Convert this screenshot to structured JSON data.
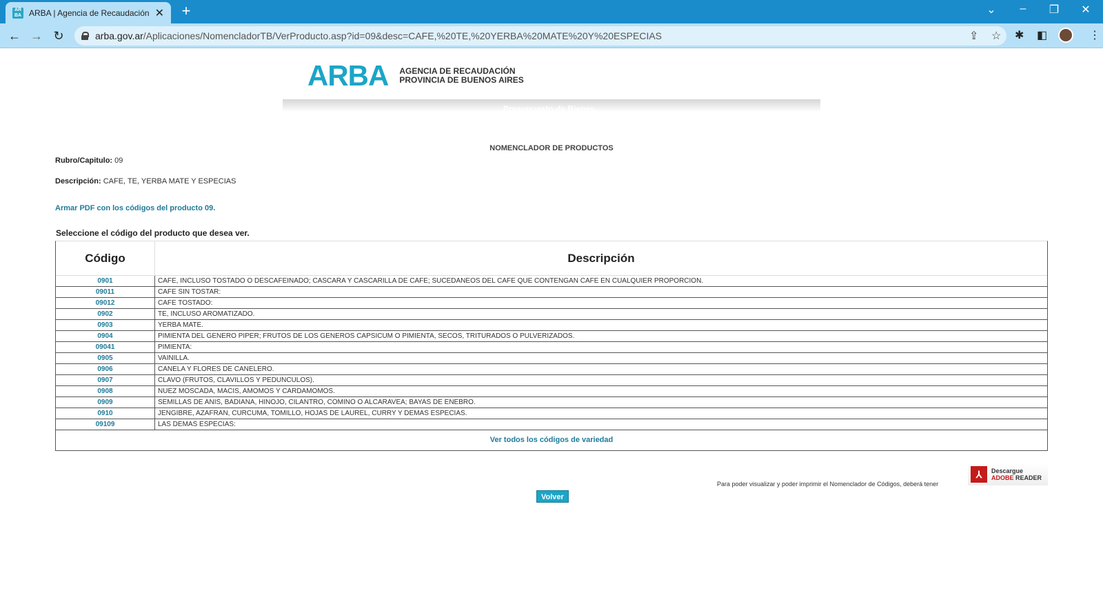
{
  "browser": {
    "tab_title": "ARBA | Agencia de Recaudación de la Provincia",
    "url_host": "arba.gov.ar",
    "url_path": "/Aplicaciones/NomencladorTB/VerProducto.asp?id=09&desc=CAFE,%20TE,%20YERBA%20MATE%20Y%20ESPECIAS"
  },
  "header": {
    "logo": "ARBA",
    "logo_sub_1": "AGENCIA DE RECAUDACIÓN",
    "logo_sub_2": "PROVINCIA DE BUENOS AIRES",
    "banner_text": "Presupuesto de Bienes"
  },
  "main": {
    "heading": "NOMENCLADOR DE PRODUCTOS",
    "rubro_label": "Rubro/Capitulo:",
    "rubro_value": "09",
    "desc_label": "Descripción:",
    "desc_value": "CAFE, TE, YERBA MATE Y ESPECIAS",
    "pdf_link": "Armar PDF con los códigos del producto 09.",
    "select_label": "Seleccione el código del producto que desea ver.",
    "table": {
      "col_code": "Código",
      "col_desc": "Descripción",
      "rows": [
        {
          "code": "0901",
          "desc": "CAFE, INCLUSO TOSTADO O DESCAFEINADO; CASCARA Y CASCARILLA DE CAFE; SUCEDANEOS DEL CAFE QUE CONTENGAN CAFE EN CUALQUIER PROPORCION."
        },
        {
          "code": "09011",
          "desc": "CAFE SIN TOSTAR:"
        },
        {
          "code": "09012",
          "desc": "CAFE TOSTADO:"
        },
        {
          "code": "0902",
          "desc": "TE, INCLUSO AROMATIZADO."
        },
        {
          "code": "0903",
          "desc": "YERBA MATE."
        },
        {
          "code": "0904",
          "desc": "PIMIENTA DEL GENERO PIPER; FRUTOS DE LOS GENEROS CAPSICUM O PIMIENTA, SECOS, TRITURADOS O PULVERIZADOS."
        },
        {
          "code": "09041",
          "desc": "PIMIENTA:"
        },
        {
          "code": "0905",
          "desc": "VAINILLA."
        },
        {
          "code": "0906",
          "desc": "CANELA Y FLORES DE CANELERO."
        },
        {
          "code": "0907",
          "desc": "CLAVO (FRUTOS, CLAVILLOS Y PEDUNCULOS)."
        },
        {
          "code": "0908",
          "desc": "NUEZ MOSCADA, MACIS, AMOMOS Y CARDAMOMOS."
        },
        {
          "code": "0909",
          "desc": "SEMILLAS DE ANIS, BADIANA, HINOJO, CILANTRO, COMINO O ALCARAVEA; BAYAS DE ENEBRO."
        },
        {
          "code": "0910",
          "desc": "JENGIBRE, AZAFRAN, CURCUMA, TOMILLO, HOJAS DE LAUREL, CURRY Y DEMAS ESPECIAS."
        },
        {
          "code": "09109",
          "desc": "LAS DEMAS ESPECIAS:"
        }
      ],
      "footer_link": "Ver todos los códigos de variedad"
    },
    "adobe_note": "Para poder visualizar y poder imprimir el Nomenclador de Códigos, deberá tener",
    "adobe_line1": "Descargue",
    "adobe_line2_red": "ADOBE",
    "adobe_line2": "READER",
    "volver": "Volver"
  }
}
